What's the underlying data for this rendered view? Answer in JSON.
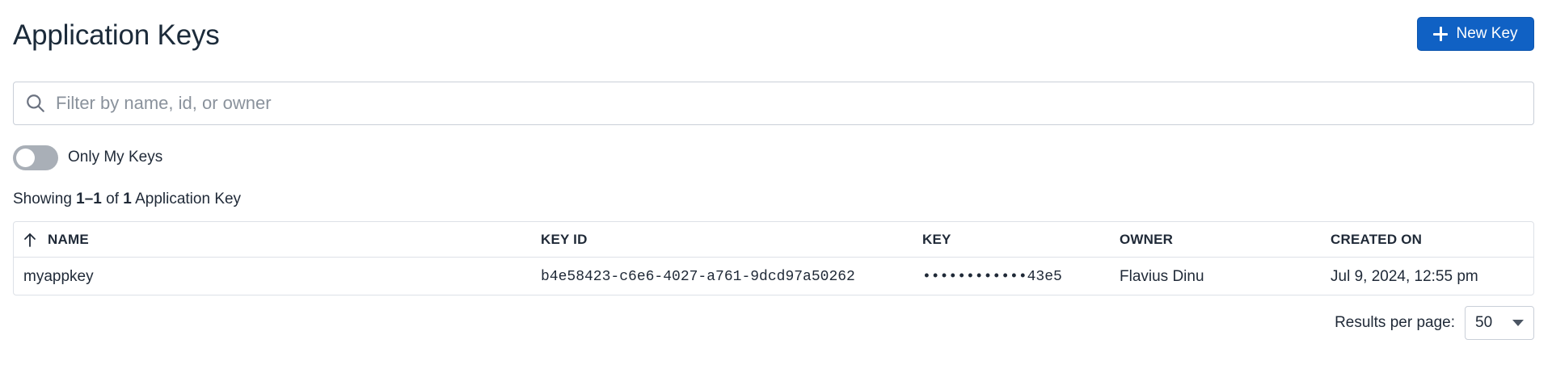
{
  "header": {
    "title": "Application Keys",
    "new_key_label": "New Key",
    "new_key_icon": "plus-icon",
    "accent_color": "#1061c4"
  },
  "search": {
    "placeholder": "Filter by name, id, or owner",
    "value": "",
    "icon": "search-icon"
  },
  "toggle": {
    "label": "Only My Keys",
    "checked": false
  },
  "summary": {
    "prefix": "Showing ",
    "range": "1–1",
    "middle": " of ",
    "total": "1",
    "suffix": " Application Key"
  },
  "table": {
    "columns": [
      {
        "label": "NAME",
        "sort": "ascending",
        "sort_icon": "arrow-up-icon"
      },
      {
        "label": "KEY ID"
      },
      {
        "label": "KEY"
      },
      {
        "label": "OWNER"
      },
      {
        "label": "CREATED ON"
      }
    ],
    "rows": [
      {
        "name": "myappkey",
        "key_id": "b4e58423-c6e6-4027-a761-9dcd97a50262",
        "key": "••••••••••••43e5",
        "owner": "Flavius Dinu",
        "created_on": "Jul 9, 2024, 12:55 pm"
      }
    ]
  },
  "pagination": {
    "results_per_page_label": "Results per page:",
    "results_per_page_value": "50"
  }
}
